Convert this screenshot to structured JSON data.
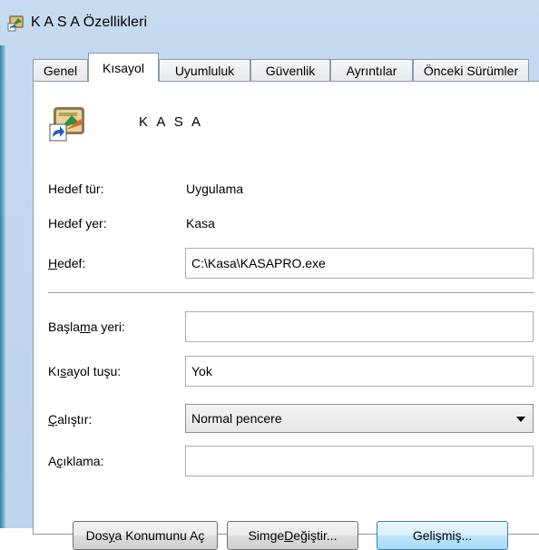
{
  "window": {
    "title": "K A S A Özellikleri"
  },
  "tabs": [
    {
      "label": "Genel"
    },
    {
      "label": "Kısayol"
    },
    {
      "label": "Uyumluluk"
    },
    {
      "label": "Güvenlik"
    },
    {
      "label": "Ayrıntılar"
    },
    {
      "label": "Önceki Sürümler"
    }
  ],
  "active_tab": "Kısayol",
  "shortcut": {
    "name": "K A S A",
    "target_type_label": "Hedef tür:",
    "target_type_value": "Uygulama",
    "target_location_label": "Hedef yer:",
    "target_location_value": "Kasa",
    "target_label_pre": "",
    "target_label_key": "H",
    "target_label_post": "edef:",
    "target_value": "C:\\Kasa\\KASAPRO.exe",
    "start_in_label_pre": "Başla",
    "start_in_label_key": "m",
    "start_in_label_post": "a yeri:",
    "start_in_value": "",
    "hotkey_label_pre": "Kı",
    "hotkey_label_key": "s",
    "hotkey_label_post": "ayol tuşu:",
    "hotkey_value": "Yok",
    "run_label_pre": "",
    "run_label_key": "Ç",
    "run_label_post": "alıştır:",
    "run_value": "Normal pencere",
    "comment_label_pre": "A",
    "comment_label_key": "ç",
    "comment_label_post": "ıklama:",
    "comment_value": ""
  },
  "buttons": {
    "open_location_pre": "Dos",
    "open_location_key": "y",
    "open_location_post": "a Konumunu Aç",
    "change_icon_pre": "Simge ",
    "change_icon_key": "D",
    "change_icon_post": "eğiştir...",
    "advanced_pre": "Gelişmiş...",
    "advanced_key": "",
    "advanced_post": ""
  }
}
